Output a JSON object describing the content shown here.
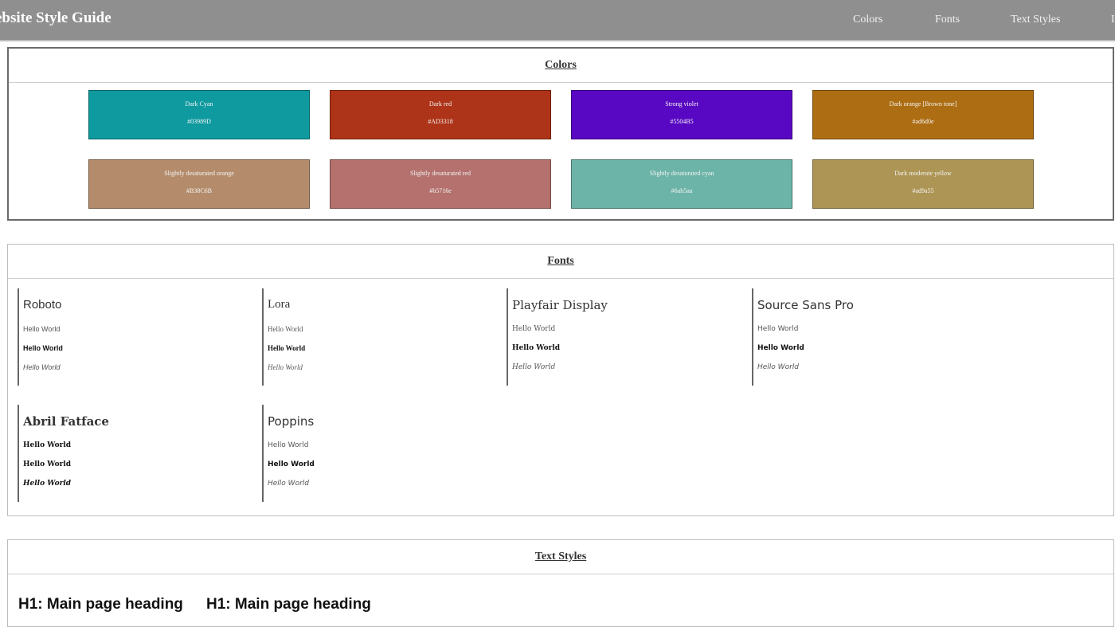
{
  "header": {
    "brand": "ebsite Style Guide",
    "nav": [
      "Colors",
      "Fonts",
      "Text Styles",
      "I"
    ]
  },
  "colors": {
    "title": "Colors",
    "swatches": [
      {
        "name": "Dark Cyan",
        "hex": "#03989D",
        "color": "#0e9a9f"
      },
      {
        "name": "Dark red",
        "hex": "#AD3318",
        "color": "#ad3418"
      },
      {
        "name": "Strong violet",
        "hex": "#5504B5",
        "color": "#5807c2"
      },
      {
        "name": "Dark orange [Brown tone]",
        "hex": "#ad6d0e",
        "color": "#ad6d12"
      },
      {
        "name": "Slightly desaturated orange",
        "hex": "#B38C6B",
        "color": "#b48c6b"
      },
      {
        "name": "Slightly desaturated red",
        "hex": "#b5716e",
        "color": "#b4716d"
      },
      {
        "name": "Slightly desaturated cyan",
        "hex": "#6ab5aa",
        "color": "#6db4a8"
      },
      {
        "name": "Dark moderate yellow",
        "hex": "#ad9a55",
        "color": "#ad9555"
      }
    ]
  },
  "fonts": {
    "title": "Fonts",
    "cards": [
      {
        "name": "Roboto",
        "samples": [
          "Hello World",
          "Hello World",
          "Hello World"
        ]
      },
      {
        "name": "Lora",
        "samples": [
          "Hello World",
          "Hello World",
          "Hello World"
        ]
      },
      {
        "name": "Playfair Display",
        "samples": [
          "Hello World",
          "Hello World",
          "Hello World"
        ]
      },
      {
        "name": "Source Sans Pro",
        "samples": [
          "Hello World",
          "Hello World",
          "Hello World"
        ]
      },
      {
        "name": "Abril Fatface",
        "samples": [
          "Hello World",
          "Hello World",
          "Hello World"
        ]
      },
      {
        "name": "Poppins",
        "samples": [
          "Hello World",
          "Hello World",
          "Hello World"
        ]
      }
    ]
  },
  "text_styles": {
    "title": "Text Styles",
    "h1_samples": [
      "H1: Main page heading",
      "H1: Main page heading"
    ]
  }
}
